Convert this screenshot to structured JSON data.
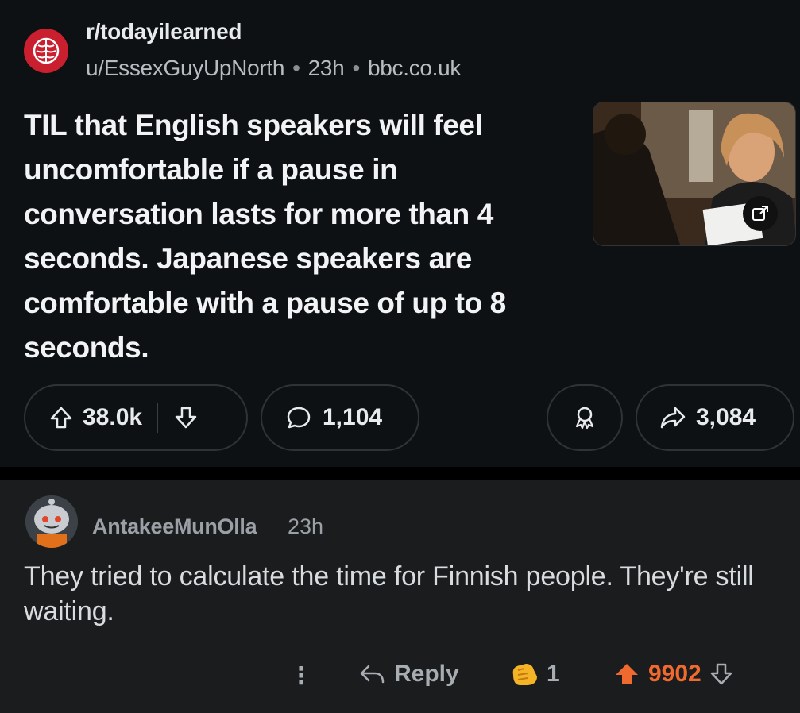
{
  "post": {
    "subreddit": "r/todayilearned",
    "author": "u/EssexGuyUpNorth",
    "age": "23h",
    "domain": "bbc.co.uk",
    "title": "TIL that English speakers will feel uncomfortable if a pause in conversation lasts for more than 4 seconds. Japanese speakers are comfortable with a pause of up to 8 seconds.",
    "upvotes": "38.0k",
    "comments": "1,104",
    "shares": "3,084",
    "thumbnail_icon": "external-link-icon"
  },
  "comment": {
    "author": "AntakeeMunOlla",
    "age": "23h",
    "body": "They tried to calculate the time for Finnish people. They're still waiting.",
    "reply_label": "Reply",
    "awards": "1",
    "score": "9902"
  },
  "colors": {
    "background": "#0e1113",
    "comment_background": "#1a1c1e",
    "subreddit_icon": "#c91f2f",
    "upvote_active": "#f0692e"
  }
}
